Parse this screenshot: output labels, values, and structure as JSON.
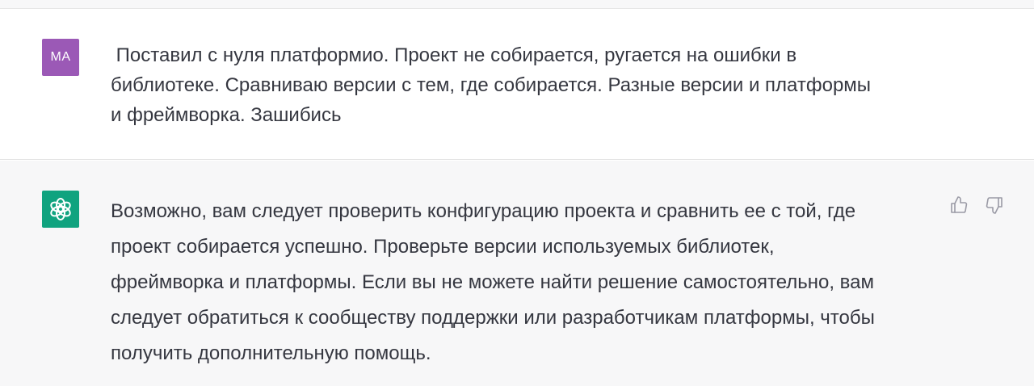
{
  "user_message": {
    "avatar_initials": "MA",
    "avatar_color": "#9b59b6",
    "text": " Поставил с нуля платформио. Проект не собирается, ругается на ошибки в\nбиблиотеке. Сравниваю версии с тем, где собирается. Разные версии и платформы\nи фреймворка. Зашибись"
  },
  "assistant_message": {
    "avatar_icon": "openai-logo-icon",
    "avatar_color": "#10a37f",
    "text": "Возможно, вам следует проверить конфигурацию проекта и сравнить ее с той, где\nпроект собирается успешно. Проверьте версии используемых библиотек,\nфреймворка и платформы. Если вы не можете найти решение самостоятельно, вам\nследует обратиться к сообществу поддержки или разработчикам платформы, чтобы\nполучить дополнительную помощь.",
    "feedback": {
      "thumbs_up_icon": "thumbs-up-icon",
      "thumbs_down_icon": "thumbs-down-icon"
    }
  }
}
